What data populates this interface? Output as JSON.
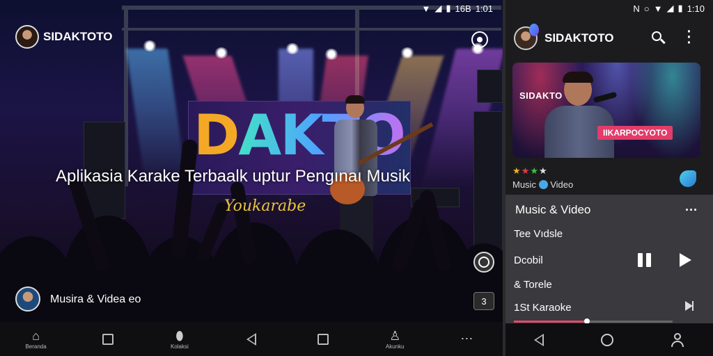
{
  "left_screen": {
    "status_bar": {
      "time": "1:01",
      "signal_label": "16B"
    },
    "header": {
      "app_name": "SIDAKTOTO"
    },
    "hero": {
      "logo_text_first": "D",
      "logo_text_rest": "AKTO",
      "title": "Aplikasia Karake Terbaalk uptur Pengınaı Musik",
      "subtitle": "Youkarabe"
    },
    "bottom": {
      "caption": "Musira & Videa eo",
      "square_button_label": "3"
    },
    "navbar": {
      "items": [
        {
          "icon": "home-icon",
          "label": "Beranda"
        },
        {
          "icon": "square-icon",
          "label": ""
        },
        {
          "icon": "shield-icon",
          "label": "Kolaksi"
        },
        {
          "icon": "back-icon",
          "label": ""
        },
        {
          "icon": "square-icon",
          "label": ""
        },
        {
          "icon": "profile-icon",
          "label": "Akunku"
        },
        {
          "icon": "more-icon",
          "label": ""
        }
      ]
    }
  },
  "right_screen": {
    "status_bar": {
      "time": "1:10"
    },
    "header": {
      "app_name": "SIDAKTOTO"
    },
    "card": {
      "logo_text": "SIDAKTO",
      "badge": "IIKARPOCYOTO"
    },
    "rating": {
      "stars": 4
    },
    "subtitle_left": "Music",
    "subtitle_right": "Video",
    "list": {
      "title": "Music & Video",
      "rows": [
        {
          "label": "Tee Vıdsle"
        },
        {
          "label": "Dcobil"
        },
        {
          "label": "& Torele"
        },
        {
          "label": "1St Karaoke"
        }
      ],
      "progress": 0.46
    }
  },
  "colors": {
    "accent_pink": "#e23c6a",
    "accent_gold": "#f3a925",
    "accent_cyan": "#44e0c8",
    "panel_bg": "#3a3a3e",
    "navbar_bg": "#0f0f12"
  }
}
